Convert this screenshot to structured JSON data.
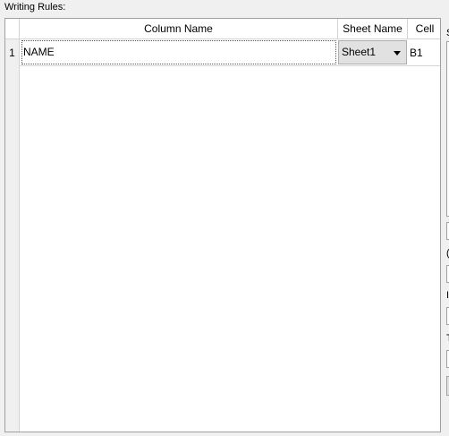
{
  "section": {
    "label": "Writing Rules:"
  },
  "grid": {
    "headers": {
      "column_name": "Column Name",
      "sheet_name": "Sheet Name",
      "cell": "Cell"
    },
    "rows": [
      {
        "row_number": "1",
        "column_name": "NAME",
        "sheet_name": "Sheet1",
        "cell": "B1"
      }
    ]
  },
  "right_panel": {
    "label_top": "S",
    "label_2": "(",
    "label_3": "I",
    "label_4": "T"
  }
}
